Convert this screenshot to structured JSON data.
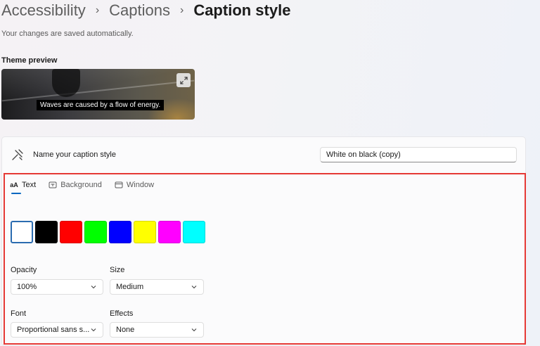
{
  "breadcrumb": {
    "items": [
      "Accessibility",
      "Captions"
    ],
    "current": "Caption style",
    "separator": "›"
  },
  "saved_note": "Your changes are saved automatically.",
  "preview": {
    "label": "Theme preview",
    "caption": "Waves are caused by a flow of energy."
  },
  "name_row": {
    "label": "Name your caption style",
    "value": "White on black (copy)"
  },
  "tabs": [
    {
      "label": "Text",
      "active": true,
      "icon": "text-size-icon"
    },
    {
      "label": "Background",
      "active": false,
      "icon": "background-icon"
    },
    {
      "label": "Window",
      "active": false,
      "icon": "window-icon"
    }
  ],
  "swatches": [
    {
      "color": "#ffffff",
      "selected": true
    },
    {
      "color": "#000000",
      "selected": false
    },
    {
      "color": "#ff0000",
      "selected": false
    },
    {
      "color": "#00ff00",
      "selected": false
    },
    {
      "color": "#0000ff",
      "selected": false
    },
    {
      "color": "#ffff00",
      "selected": false
    },
    {
      "color": "#ff00ff",
      "selected": false
    },
    {
      "color": "#00ffff",
      "selected": false
    }
  ],
  "fields": {
    "opacity": {
      "label": "Opacity",
      "value": "100%"
    },
    "size": {
      "label": "Size",
      "value": "Medium"
    },
    "font": {
      "label": "Font",
      "value": "Proportional sans s..."
    },
    "effects": {
      "label": "Effects",
      "value": "None"
    }
  },
  "colors": {
    "accent": "#0067c0",
    "highlight_border": "#e53935"
  }
}
